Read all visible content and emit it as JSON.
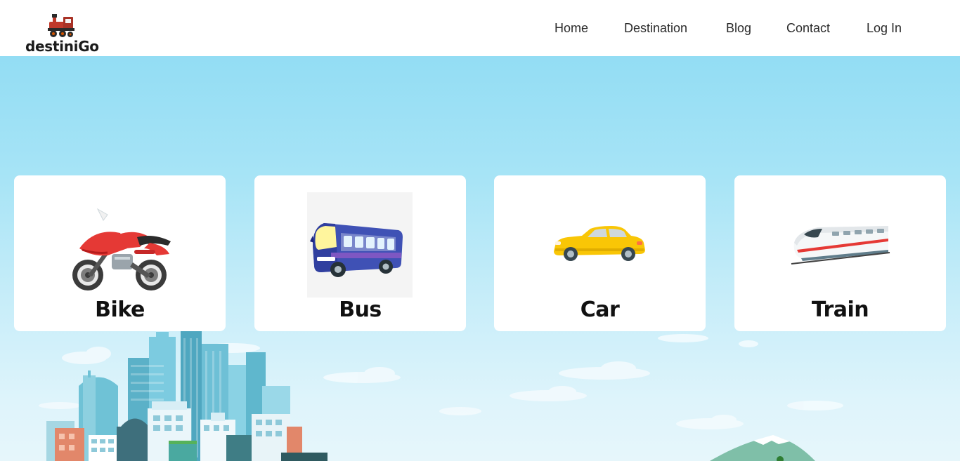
{
  "brand": {
    "name": "destiniGo",
    "logo_icon": "steam-locomotive-icon"
  },
  "nav": {
    "items": [
      {
        "label": "Home"
      },
      {
        "label": "Destination"
      },
      {
        "label": "Blog"
      },
      {
        "label": "Contact"
      },
      {
        "label": "Log In"
      }
    ]
  },
  "transport": {
    "cards": [
      {
        "label": "Bike",
        "icon": "motorbike-icon"
      },
      {
        "label": "Bus",
        "icon": "bus-icon"
      },
      {
        "label": "Car",
        "icon": "car-icon"
      },
      {
        "label": "Train",
        "icon": "bullet-train-icon"
      }
    ]
  },
  "colors": {
    "sky_top": "#93ddf4",
    "sky_bottom": "#e6f6fb",
    "card_background": "#ffffff",
    "label_text": "#111111",
    "nav_text": "#2b2b2b"
  }
}
